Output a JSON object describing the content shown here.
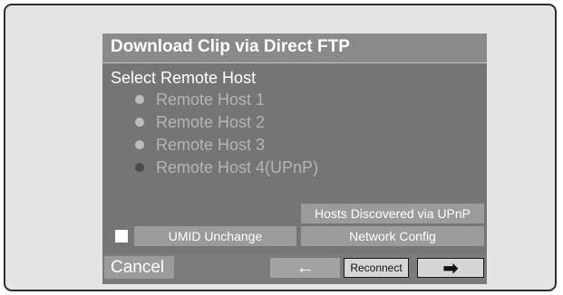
{
  "dialog": {
    "title": "Download Clip via Direct FTP"
  },
  "remote_host": {
    "section_label": "Select Remote Host",
    "hosts": [
      {
        "label": "Remote Host 1",
        "state": "available"
      },
      {
        "label": "Remote Host 2",
        "state": "available"
      },
      {
        "label": "Remote Host 3",
        "state": "available"
      },
      {
        "label": "Remote Host 4(UPnP)",
        "state": "dim"
      }
    ]
  },
  "buttons": {
    "hosts_discovered": "Hosts Discovered via UPnP",
    "umid_unchange": "UMID Unchange",
    "network_config": "Network Config",
    "cancel": "Cancel",
    "back_arrow": "←",
    "reconnect": "Reconnect",
    "next_arrow": "➡"
  },
  "umid_checkbox": {
    "checked": false
  },
  "colors": {
    "panel": "#8a8a8a",
    "body": "#757575",
    "button": "#9b9b9b",
    "text": "#ffffff",
    "disabled_text": "#b5b5b5"
  }
}
